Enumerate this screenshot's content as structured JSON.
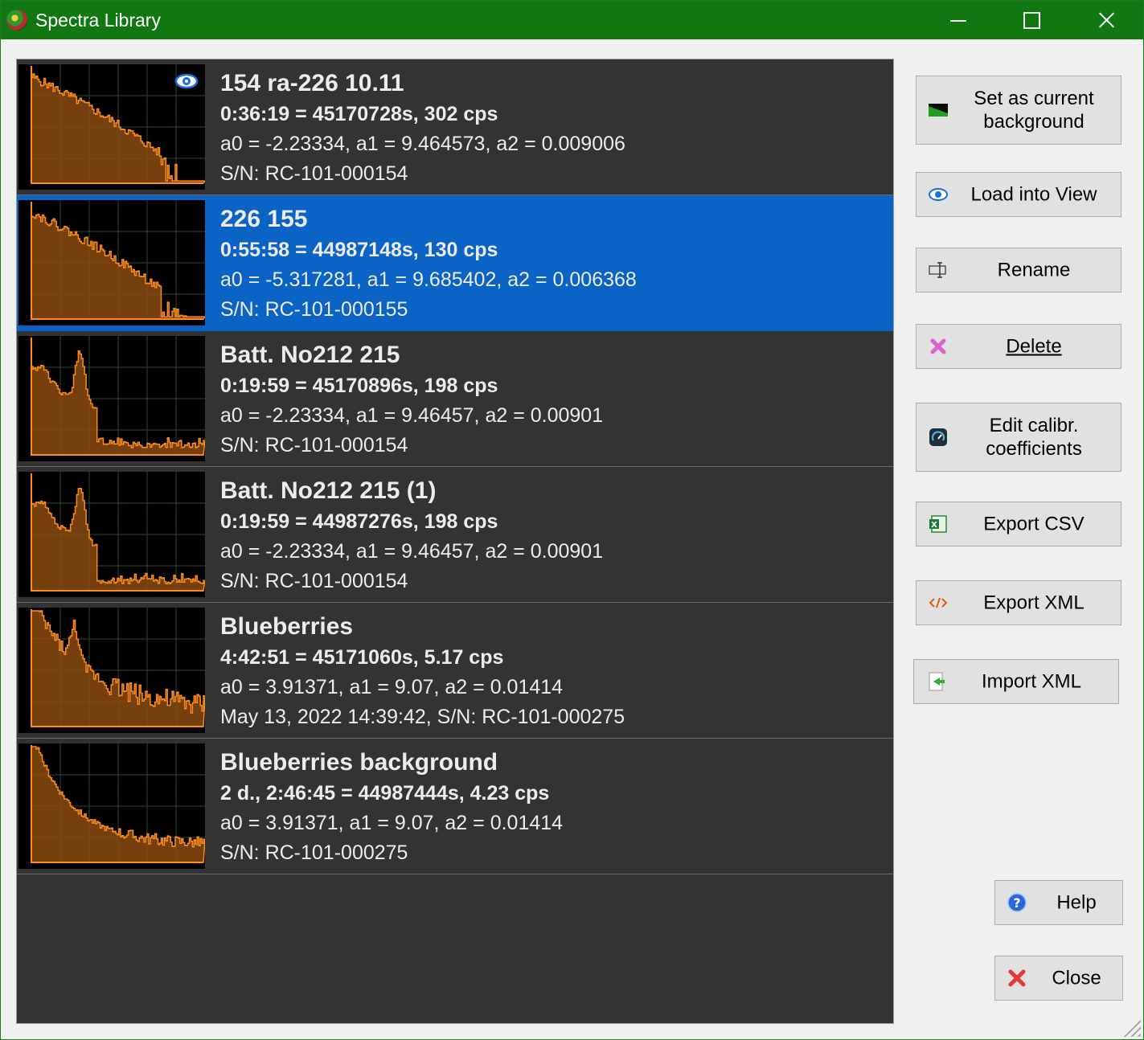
{
  "window": {
    "title": "Spectra Library"
  },
  "spectra": [
    {
      "name": "154 ra-226 10.11",
      "stats": "0:36:19 = 45170728s, 302 cps",
      "coefficients": "a0 = -2.23334, a1 = 9.464573, a2 = 0.009006",
      "info": "S/N: RC-101-000154",
      "selected": false,
      "in_view": true
    },
    {
      "name": "226 155",
      "stats": "0:55:58 = 44987148s, 130 cps",
      "coefficients": "a0 = -5.317281, a1 = 9.685402, a2 = 0.006368",
      "info": "S/N: RC-101-000155",
      "selected": true,
      "in_view": false
    },
    {
      "name": "Batt. No212 215",
      "stats": "0:19:59 = 45170896s, 198 cps",
      "coefficients": "a0 = -2.23334, a1 = 9.46457, a2 = 0.00901",
      "info": "S/N: RC-101-000154",
      "selected": false,
      "in_view": false
    },
    {
      "name": "Batt. No212 215 (1)",
      "stats": "0:19:59 = 44987276s, 198 cps",
      "coefficients": "a0 = -2.23334, a1 = 9.46457, a2 = 0.00901",
      "info": "S/N: RC-101-000154",
      "selected": false,
      "in_view": false
    },
    {
      "name": "Blueberries",
      "stats": "4:42:51 = 45171060s, 5.17 cps",
      "coefficients": "a0 = 3.91371, a1 = 9.07, a2 = 0.01414",
      "info": "May 13, 2022  14:39:42, S/N: RC-101-000275",
      "selected": false,
      "in_view": false
    },
    {
      "name": "Blueberries background",
      "stats": "2 d., 2:46:45 = 44987444s, 4.23 cps",
      "coefficients": "a0 = 3.91371, a1 = 9.07, a2 = 0.01414",
      "info": "S/N: RC-101-000275",
      "selected": false,
      "in_view": false
    }
  ],
  "buttons": {
    "set_background": "Set as current background",
    "load_view": "Load into View",
    "rename": "Rename",
    "delete": "Delete",
    "edit_calibration": "Edit calibr. coefficients",
    "export_csv": "Export CSV",
    "export_xml": "Export XML",
    "import_xml": "Import XML",
    "help": "Help",
    "close": "Close"
  },
  "colors": {
    "spectrum_fill": "#8a4a10",
    "spectrum_line": "#ff8c1a",
    "selected_row": "#0b63c5",
    "list_bg": "#333333",
    "titlebar": "#117711"
  }
}
